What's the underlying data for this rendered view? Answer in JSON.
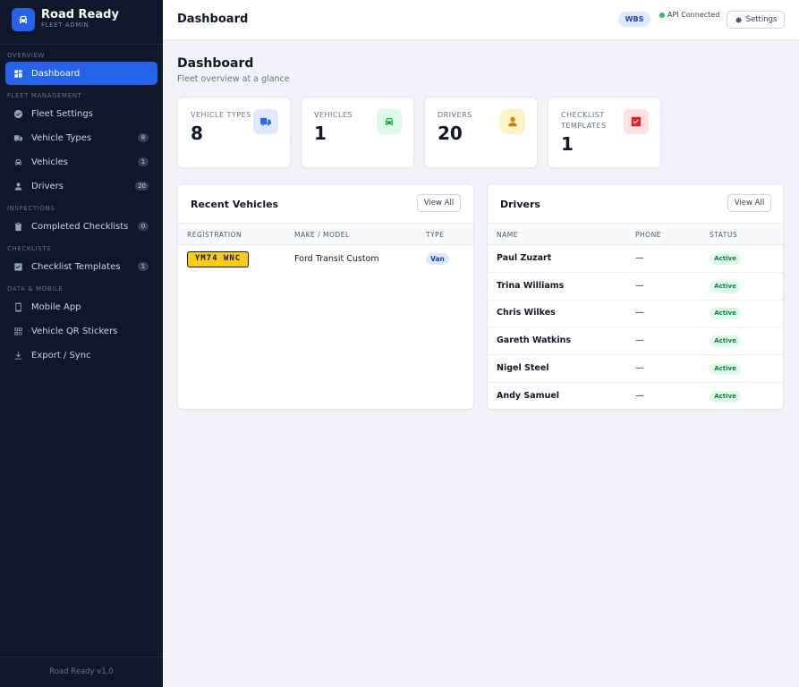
{
  "brand": {
    "name": "Road Ready",
    "subtitle": "FLEET ADMIN"
  },
  "sidebar": {
    "sections": [
      {
        "title": "OVERVIEW",
        "items": [
          {
            "label": "Dashboard",
            "icon": "grid-icon",
            "active": true
          }
        ]
      },
      {
        "title": "FLEET MANAGEMENT",
        "items": [
          {
            "label": "Fleet Settings",
            "icon": "check-circle-icon"
          },
          {
            "label": "Vehicle Types",
            "icon": "truck-icon",
            "badge": "8"
          },
          {
            "label": "Vehicles",
            "icon": "car-icon",
            "badge": "1"
          },
          {
            "label": "Drivers",
            "icon": "person-icon",
            "badge": "20"
          }
        ]
      },
      {
        "title": "INSPECTIONS",
        "items": [
          {
            "label": "Completed Checklists",
            "icon": "clipboard-icon",
            "badge": "0"
          }
        ]
      },
      {
        "title": "CHECKLISTS",
        "items": [
          {
            "label": "Checklist Templates",
            "icon": "checkbox-icon",
            "badge": "1"
          }
        ]
      },
      {
        "title": "DATA & MOBILE",
        "items": [
          {
            "label": "Mobile App",
            "icon": "phone-icon"
          },
          {
            "label": "Vehicle QR Stickers",
            "icon": "qr-icon"
          },
          {
            "label": "Export / Sync",
            "icon": "download-icon"
          }
        ]
      }
    ],
    "footer": "Road Ready v1.0"
  },
  "topbar": {
    "title": "Dashboard",
    "org_badge": "WBS",
    "api_status": "API Connected",
    "settings_label": "Settings"
  },
  "page": {
    "title": "Dashboard",
    "subtitle": "Fleet overview at a glance"
  },
  "stats": [
    {
      "label": "VEHICLE TYPES",
      "value": "8",
      "icon": "truck-icon",
      "color": "#2563eb",
      "bg": "#dbeafe"
    },
    {
      "label": "VEHICLES",
      "value": "1",
      "icon": "car-icon",
      "color": "#16a34a",
      "bg": "#dcfce7"
    },
    {
      "label": "DRIVERS",
      "value": "20",
      "icon": "person-icon",
      "color": "#d97706",
      "bg": "#fef3c7"
    },
    {
      "label": "CHECKLIST TEMPLATES",
      "value": "1",
      "icon": "checkbox-icon",
      "color": "#dc2626",
      "bg": "#fee2e2"
    }
  ],
  "recent_vehicles": {
    "title": "Recent Vehicles",
    "view_all": "View All",
    "columns": [
      "REGISTRATION",
      "MAKE / MODEL",
      "TYPE"
    ],
    "rows": [
      {
        "registration": "YM74 WNC",
        "make_model": "Ford Transit Custom",
        "type": "Van"
      }
    ]
  },
  "drivers": {
    "title": "Drivers",
    "view_all": "View All",
    "columns": [
      "NAME",
      "PHONE",
      "STATUS"
    ],
    "rows": [
      {
        "name": "Paul Zuzart",
        "phone": "—",
        "status": "Active"
      },
      {
        "name": "Trina Williams",
        "phone": "—",
        "status": "Active"
      },
      {
        "name": "Chris Wilkes",
        "phone": "—",
        "status": "Active"
      },
      {
        "name": "Gareth Watkins",
        "phone": "—",
        "status": "Active"
      },
      {
        "name": "Nigel Steel",
        "phone": "—",
        "status": "Active"
      },
      {
        "name": "Andy Samuel",
        "phone": "—",
        "status": "Active"
      }
    ]
  }
}
